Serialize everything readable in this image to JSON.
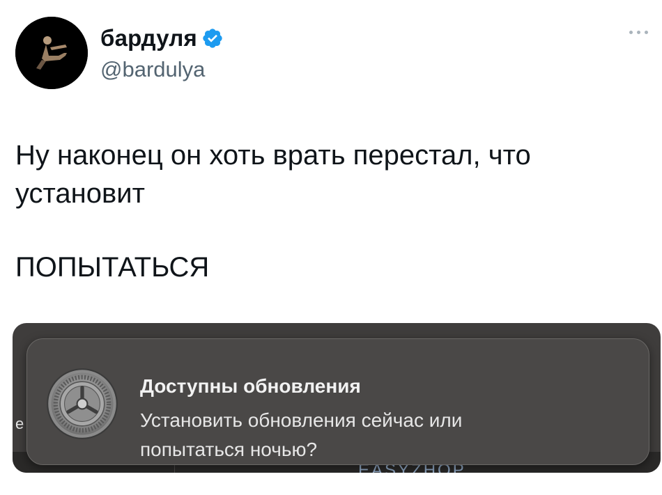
{
  "author": {
    "display_name": "бардуля",
    "handle": "@bardulya",
    "verified": true
  },
  "post": {
    "text_line1": "Ну наконец он хоть врать перестал, что",
    "text_line2": "установит",
    "text_line3": "ПОПЫТАТЬСЯ"
  },
  "embedded_screenshot": {
    "notification": {
      "title": "Доступны обновления",
      "body_line1": "Установить обновления сейчас или",
      "body_line2": "попытаться ночью?",
      "icon": "system-preferences-gear-icon"
    },
    "edge_letter": "е",
    "watermark": "EASYZHOP"
  },
  "colors": {
    "verified_badge": "#1d9bf0",
    "handle": "#536471",
    "notification_bg": "#4a4847"
  }
}
